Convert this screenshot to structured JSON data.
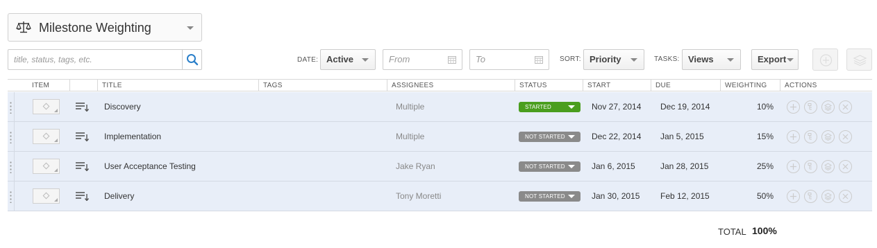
{
  "view": {
    "title": "Milestone Weighting",
    "icon": "scale-icon"
  },
  "search": {
    "placeholder": "title, status, tags, etc."
  },
  "filters": {
    "date_label": "DATE:",
    "date_value": "Active",
    "from_placeholder": "From",
    "to_placeholder": "To",
    "sort_label": "SORT:",
    "sort_value": "Priority",
    "tasks_label": "TASKS:",
    "tasks_value": "Views",
    "export_label": "Export"
  },
  "columns": [
    "ITEM",
    "TITLE",
    "TAGS",
    "ASSIGNEES",
    "STATUS",
    "START",
    "DUE",
    "WEIGHTING",
    "ACTIONS"
  ],
  "rows": [
    {
      "title": "Discovery",
      "tags": "",
      "assignees": "Multiple",
      "status": "STARTED",
      "start": "Nov 27, 2014",
      "due": "Dec 19, 2014",
      "weighting": "10%"
    },
    {
      "title": "Implementation",
      "tags": "",
      "assignees": "Multiple",
      "status": "NOT STARTED",
      "start": "Dec 22, 2014",
      "due": "Jan 5, 2015",
      "weighting": "15%"
    },
    {
      "title": "User Acceptance Testing",
      "tags": "",
      "assignees": "Jake Ryan",
      "status": "NOT STARTED",
      "start": "Jan 6, 2015",
      "due": "Jan 28, 2015",
      "weighting": "25%"
    },
    {
      "title": "Delivery",
      "tags": "",
      "assignees": "Tony Moretti",
      "status": "NOT STARTED",
      "start": "Jan 30, 2015",
      "due": "Feb 12, 2015",
      "weighting": "50%"
    }
  ],
  "status_colors": {
    "STARTED": "#4a9e1e",
    "NOT STARTED": "#8a8a8a"
  },
  "total": {
    "label": "TOTAL",
    "value": "100%"
  }
}
